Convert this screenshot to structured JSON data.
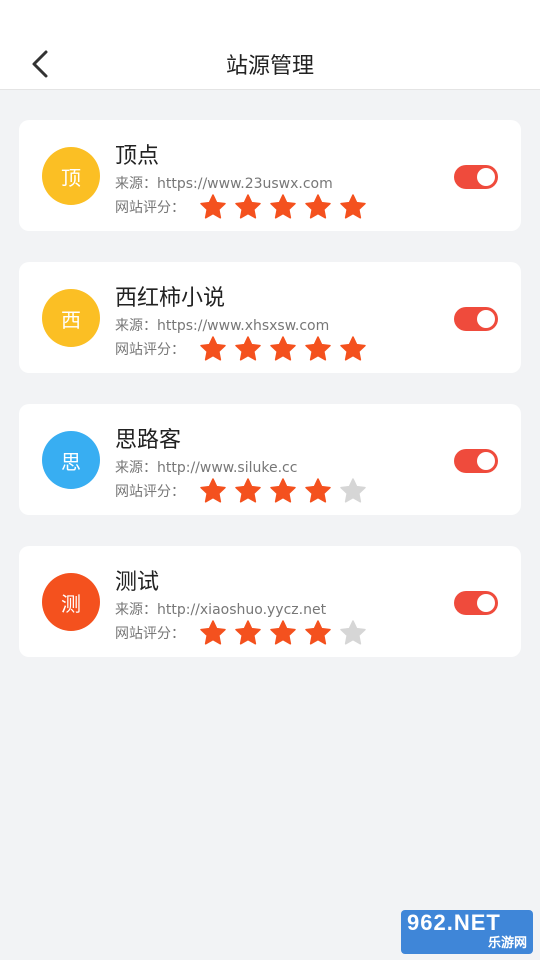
{
  "header": {
    "back_icon": "chevron-left-icon",
    "title": "站源管理"
  },
  "colors": {
    "star_on": "#f4511e",
    "star_off": "#d6d6d6",
    "toggle_on": "#ef4b3c"
  },
  "sources": [
    {
      "avatar_char": "顶",
      "avatar_color": "#fbbf24",
      "name": "顶点",
      "source_text": "来源：https://www.23uswx.com",
      "rating_label": "网站评分：",
      "rating": 5,
      "rating_max": 5,
      "enabled": true
    },
    {
      "avatar_char": "西",
      "avatar_color": "#fbbf24",
      "name": "西红柿小说",
      "source_text": "来源：https://www.xhsxsw.com",
      "rating_label": "网站评分：",
      "rating": 5,
      "rating_max": 5,
      "enabled": true
    },
    {
      "avatar_char": "思",
      "avatar_color": "#38aef2",
      "name": "思路客",
      "source_text": "来源：http://www.siluke.cc",
      "rating_label": "网站评分：",
      "rating": 4,
      "rating_max": 5,
      "enabled": true
    },
    {
      "avatar_char": "测",
      "avatar_color": "#f4511e",
      "name": "测试",
      "source_text": "来源：http://xiaoshuo.yycz.net",
      "rating_label": "网站评分：",
      "rating": 4,
      "rating_max": 5,
      "enabled": true
    }
  ],
  "watermark": {
    "top": "962.NET",
    "bottom": "乐游网"
  }
}
